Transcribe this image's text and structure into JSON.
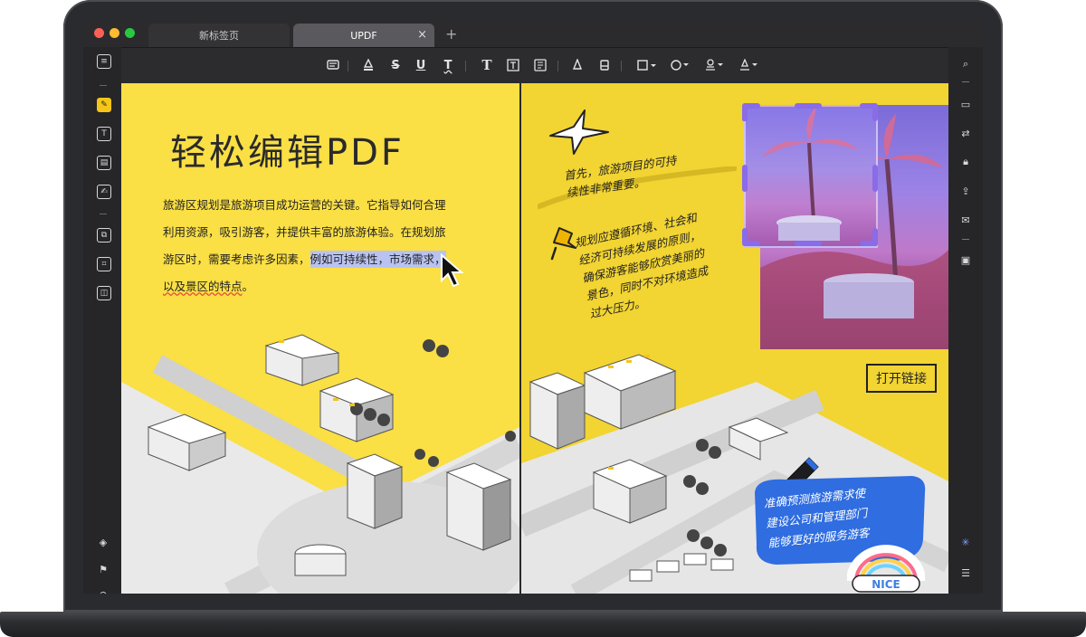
{
  "tabs": [
    {
      "label": "新标签页",
      "active": false
    },
    {
      "label": "UPDF",
      "active": true
    }
  ],
  "tab_close_icon": "×",
  "new_tab_icon": "+",
  "toolbar": {
    "tools": [
      "comment-icon",
      "highlight-icon",
      "strikethrough-icon",
      "underline-icon",
      "squiggly-icon",
      "text-icon",
      "textbox-icon",
      "text-callout-icon",
      "pencil-icon",
      "eraser-icon",
      "shape-icon",
      "sticker-icon",
      "stamp-icon",
      "signature-icon"
    ],
    "glyphs": {
      "s": "S",
      "u": "U",
      "t": "T",
      "text": "T"
    }
  },
  "document": {
    "title": "轻松编辑PDF",
    "paragraph_lines": [
      "旅游区规划是旅游项目成功运营的关键。它指导如何合理",
      "利用资源，吸引游客，并提供丰富的旅游体验。在规划旅",
      "游区时，需要考虑许多因素，"
    ],
    "highlighted_text": "例如可持续性，市场需求，",
    "squiggly_text": "以及景区的特点",
    "squiggly_tail": "。",
    "note1_lines": [
      "首先，旅游项目的可持",
      "续性非常重要。"
    ],
    "note2_lines": [
      "规划应遵循环境、社会和",
      "经济可持续发展的原则，",
      "确保游客能够欣赏美丽的",
      "景色，同时不对环境造成",
      "过大压力。"
    ],
    "link_button": "打开链接",
    "note3_lines": [
      "准确预测旅游需求使",
      "建设公司和管理部门",
      "能够更好的服务游客"
    ],
    "sticker_text": "NICE"
  },
  "colors": {
    "page_yellow": "#fadf45",
    "highlight": "#b9c3f2",
    "accent_purple": "#8a6be8",
    "note_blue": "#2f6de0"
  }
}
